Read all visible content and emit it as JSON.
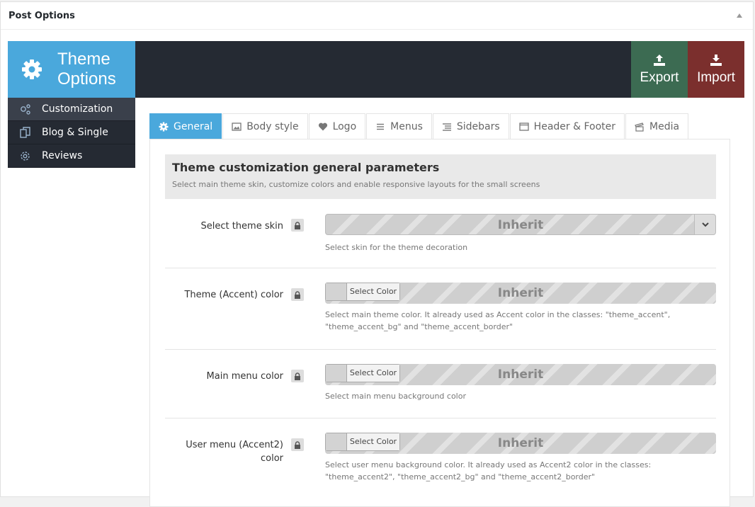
{
  "postbox": {
    "title": "Post Options"
  },
  "header": {
    "brand_title_line1": "Theme",
    "brand_title_line2": "Options",
    "export_label": "Export",
    "import_label": "Import",
    "colors": {
      "brand": "#4aa8dc",
      "export": "#3c6b52",
      "import": "#7b2f2d",
      "bar": "#252a33"
    }
  },
  "sidebar": {
    "items": [
      {
        "label": "Customization",
        "icon": "gears-icon",
        "active": true
      },
      {
        "label": "Blog & Single",
        "icon": "copy-icon",
        "active": false
      },
      {
        "label": "Reviews",
        "icon": "cog-icon",
        "active": false
      }
    ]
  },
  "tabs": [
    {
      "label": "General",
      "icon": "gear-icon",
      "active": true
    },
    {
      "label": "Body style",
      "icon": "image-icon"
    },
    {
      "label": "Logo",
      "icon": "heart-icon"
    },
    {
      "label": "Menus",
      "icon": "menu-icon"
    },
    {
      "label": "Sidebars",
      "icon": "list-icon"
    },
    {
      "label": "Header & Footer",
      "icon": "window-icon"
    },
    {
      "label": "Media",
      "icon": "media-icon"
    }
  ],
  "section": {
    "title": "Theme customization general parameters",
    "desc": "Select main theme skin, customize colors and enable responsive layouts for the small screens"
  },
  "options": [
    {
      "label": "Select theme skin",
      "type": "select",
      "value": "Inherit",
      "desc": "Select skin for the theme decoration"
    },
    {
      "label": "Theme (Accent) color",
      "type": "color",
      "value": "Inherit",
      "button": "Select Color",
      "desc_line1": "Select main theme color. It already used as Accent color in the classes: \"theme_accent\",",
      "desc_line2": "\"theme_accent_bg\" and \"theme_accent_border\""
    },
    {
      "label": "Main menu color",
      "type": "color",
      "value": "Inherit",
      "button": "Select Color",
      "desc": "Select main menu background color"
    },
    {
      "label_line1": "User menu (Accent2)",
      "label_line2": "color",
      "type": "color",
      "value": "Inherit",
      "button": "Select Color",
      "desc_line1": "Select user menu background color. It already used as Accent2 color in the classes:",
      "desc_line2": "\"theme_accent2\", \"theme_accent2_bg\" and \"theme_accent2_border\""
    }
  ]
}
